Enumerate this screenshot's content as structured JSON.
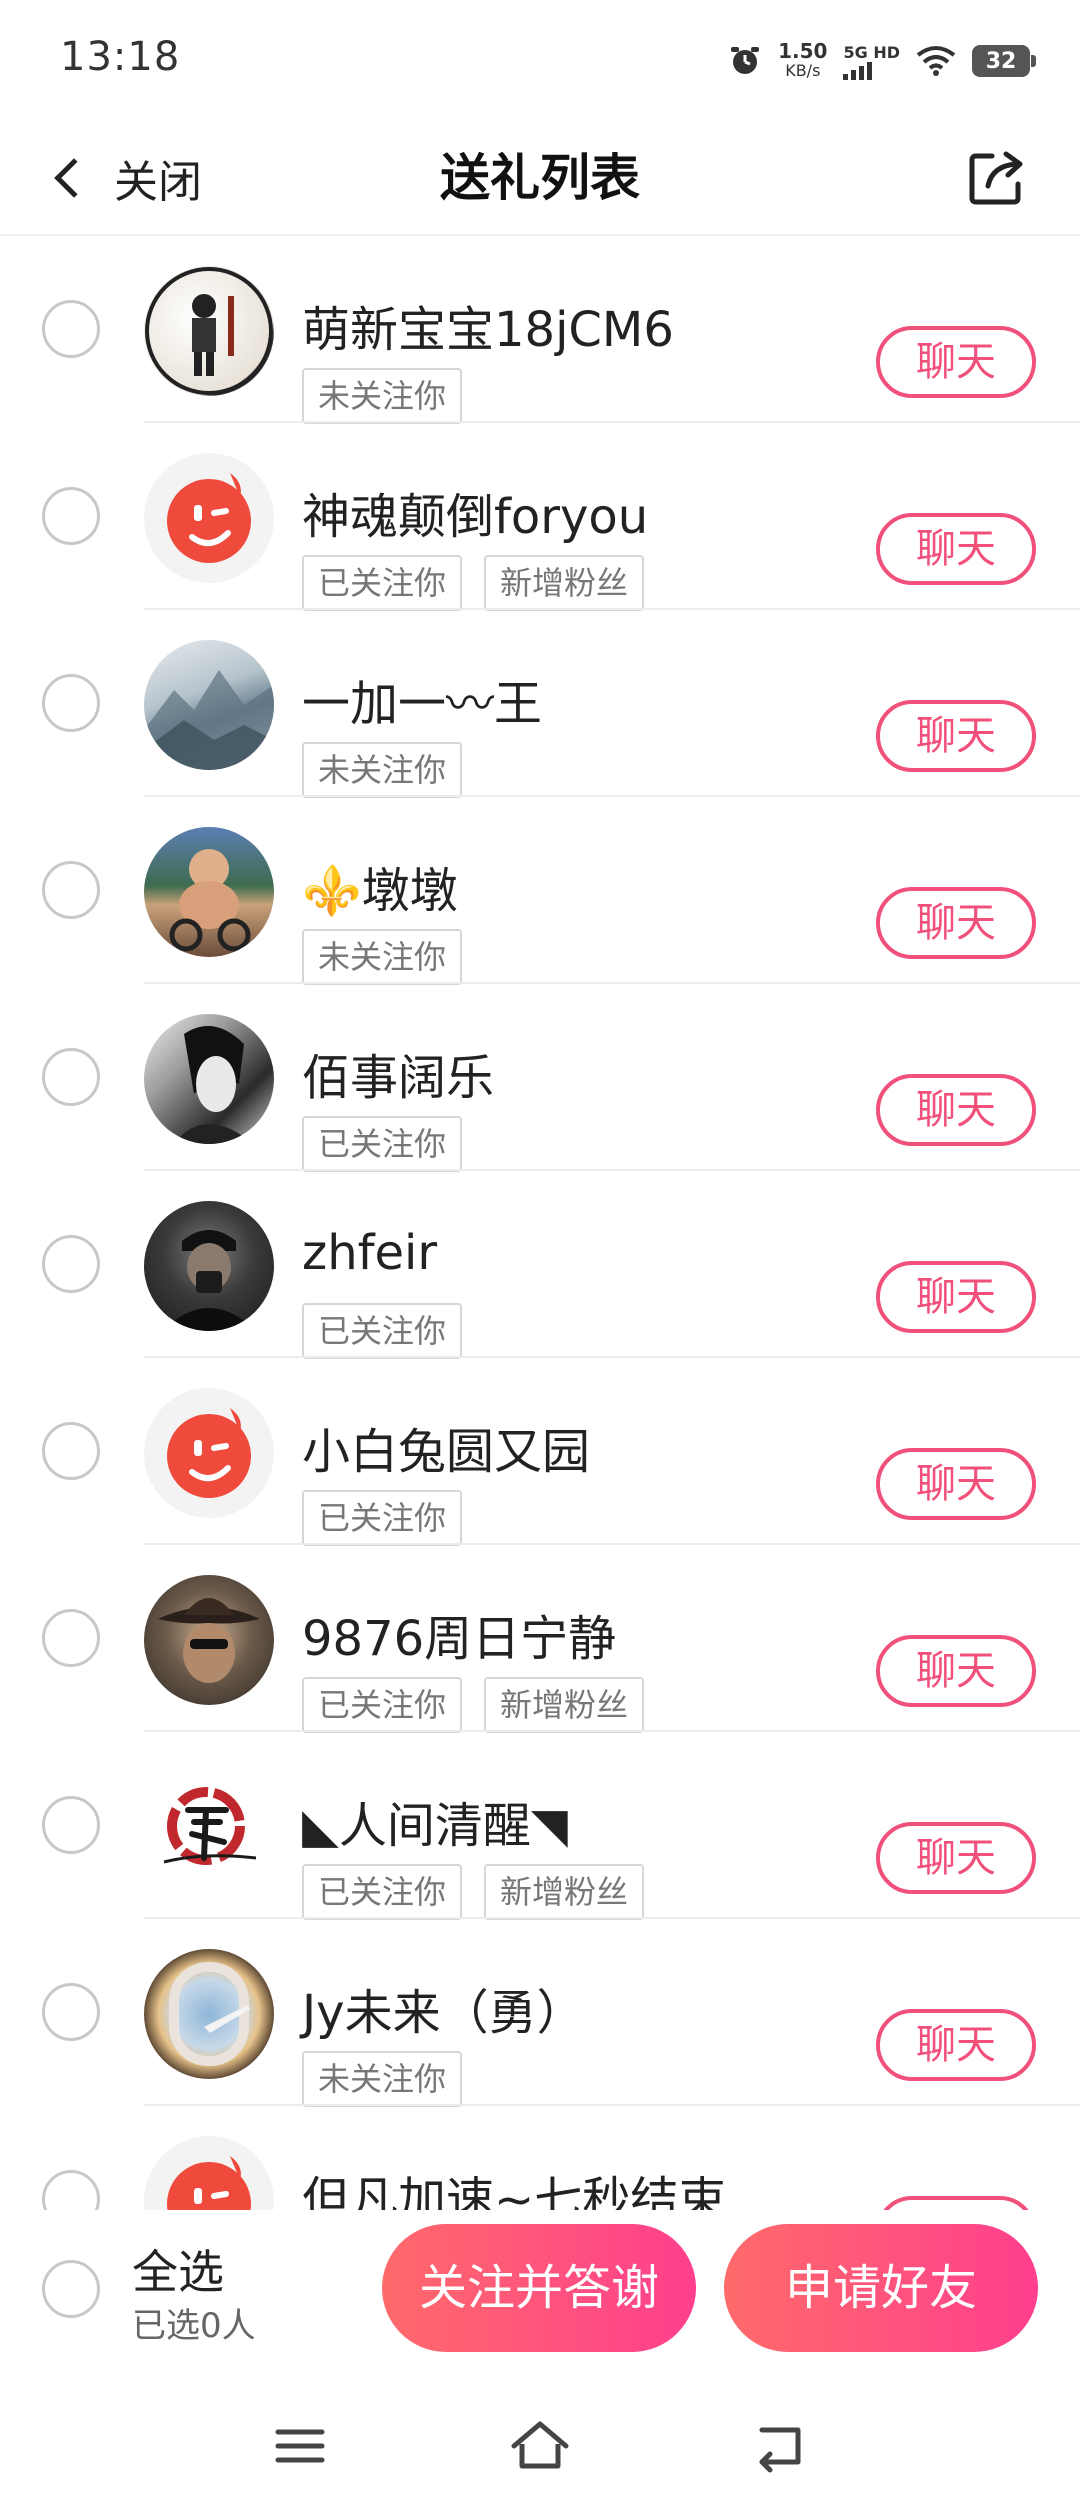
{
  "status_bar": {
    "time": "13:18",
    "net_speed": "1.50",
    "net_unit": "KB/s",
    "signal_label": "5G HD",
    "battery": "32"
  },
  "header": {
    "back_label": "关闭",
    "title": "送礼列表"
  },
  "list": {
    "rows": [
      {
        "name": "萌新宝宝18jCM6",
        "tags": [
          "未关注你"
        ],
        "chat": "聊天",
        "avatar": "comic-figure-avatar"
      },
      {
        "name": "神魂颠倒foryou",
        "tags": [
          "已关注你",
          "新增粉丝"
        ],
        "chat": "聊天",
        "avatar": "default-wink-avatar"
      },
      {
        "name": "一加一〰王",
        "tags": [
          "未关注你"
        ],
        "chat": "聊天",
        "avatar": "mountain-painting-avatar"
      },
      {
        "name": "⚜️墩墩",
        "tags": [
          "未关注你"
        ],
        "chat": "聊天",
        "avatar": "kid-on-bike-avatar"
      },
      {
        "name": "佰事阔乐",
        "tags": [
          "已关注你"
        ],
        "chat": "聊天",
        "avatar": "bw-portrait-avatar"
      },
      {
        "name": "zhfeir",
        "tags": [
          "已关注你"
        ],
        "chat": "聊天",
        "avatar": "man-with-cap-avatar"
      },
      {
        "name": "小白兔圆又园",
        "tags": [
          "已关注你"
        ],
        "chat": "聊天",
        "avatar": "default-wink-avatar"
      },
      {
        "name": "9876周日宁静",
        "tags": [
          "已关注你",
          "新增粉丝"
        ],
        "chat": "聊天",
        "avatar": "cowboy-hat-avatar"
      },
      {
        "name": "◣人间清醒◥",
        "tags": [
          "已关注你",
          "新增粉丝"
        ],
        "chat": "聊天",
        "avatar": "red-seal-avatar"
      },
      {
        "name": "Jy未来（勇）",
        "tags": [
          "未关注你"
        ],
        "chat": "聊天",
        "avatar": "airplane-window-avatar"
      },
      {
        "name": "但凡加速~七秒结束",
        "tags": [],
        "chat": "聊天",
        "avatar": "default-wink-avatar"
      }
    ]
  },
  "bottom": {
    "select_all": "全选",
    "selected_count": "已选0人",
    "follow_thanks": "关注并答谢",
    "add_friend": "申请好友"
  },
  "colors": {
    "accent": "#f0507a",
    "gradient_start": "#ff6a6a",
    "gradient_end": "#ff3f8e",
    "wink_red": "#f04a3c"
  }
}
